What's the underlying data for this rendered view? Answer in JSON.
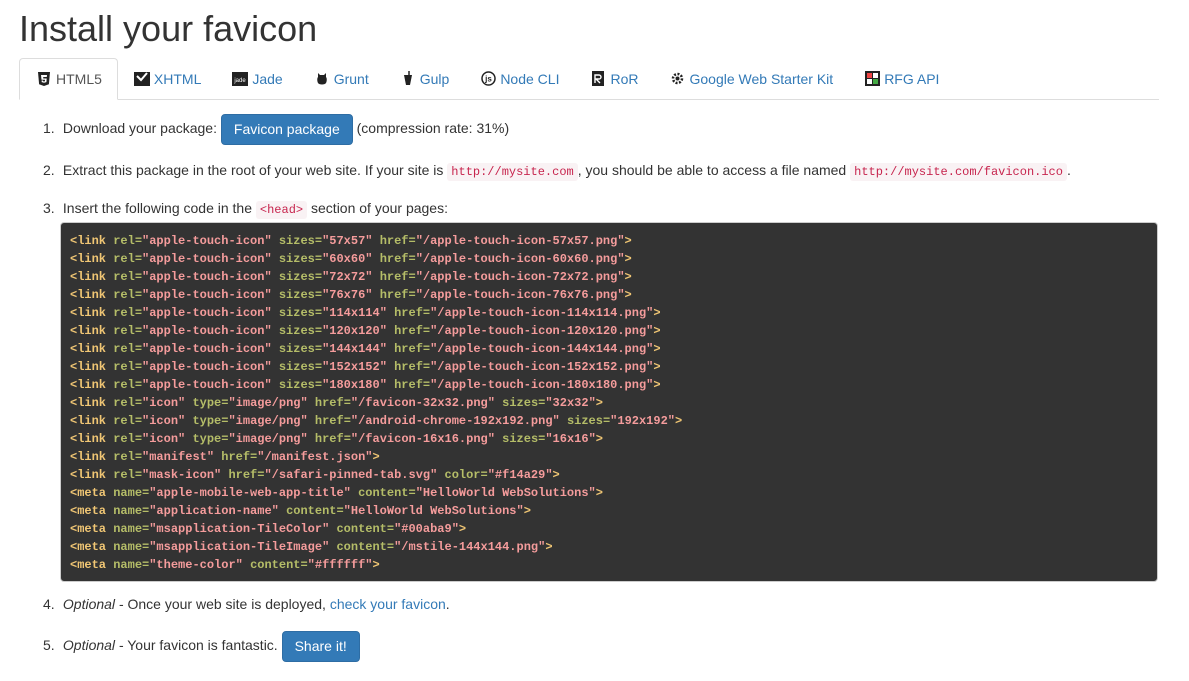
{
  "page": {
    "title": "Install your favicon"
  },
  "tabs": [
    {
      "label": "HTML5",
      "icon": "html5-icon",
      "active": true
    },
    {
      "label": "XHTML",
      "icon": "xhtml-icon"
    },
    {
      "label": "Jade",
      "icon": "jade-icon"
    },
    {
      "label": "Grunt",
      "icon": "grunt-icon"
    },
    {
      "label": "Gulp",
      "icon": "gulp-icon"
    },
    {
      "label": "Node CLI",
      "icon": "node-cli-icon"
    },
    {
      "label": "RoR",
      "icon": "ror-icon"
    },
    {
      "label": "Google Web Starter Kit",
      "icon": "gear-icon"
    },
    {
      "label": "RFG API",
      "icon": "rfg-api-icon"
    }
  ],
  "steps": {
    "s1": {
      "num": "1.",
      "text": "Download your package:",
      "button": "Favicon package",
      "after": "(compression rate: 31%)"
    },
    "s2": {
      "num": "2.",
      "text1": "Extract this package in the root of your web site. If your site is",
      "code1": "http://mysite.com",
      "text2": ", you should be able to access a file named",
      "code2": "http://mysite.com/favicon.ico",
      "text3": "."
    },
    "s3": {
      "num": "3.",
      "text1": "Insert the following code in the",
      "code": "<head>",
      "text2": "section of your pages:"
    },
    "s4": {
      "num": "4.",
      "optional": "Optional",
      "text": "- Once your web site is deployed,",
      "link": "check your favicon",
      "end": "."
    },
    "s5": {
      "num": "5.",
      "optional": "Optional",
      "text": "- Your favicon is fantastic.",
      "button": "Share it!"
    }
  },
  "code_lines": [
    [
      [
        "t",
        "<link "
      ],
      [
        "a",
        "rel="
      ],
      [
        "s",
        "\"apple-touch-icon\" "
      ],
      [
        "a",
        "sizes="
      ],
      [
        "s",
        "\"57x57\" "
      ],
      [
        "a",
        "href="
      ],
      [
        "s",
        "\"/apple-touch-icon-57x57.png\""
      ],
      [
        "t",
        ">"
      ]
    ],
    [
      [
        "t",
        "<link "
      ],
      [
        "a",
        "rel="
      ],
      [
        "s",
        "\"apple-touch-icon\" "
      ],
      [
        "a",
        "sizes="
      ],
      [
        "s",
        "\"60x60\" "
      ],
      [
        "a",
        "href="
      ],
      [
        "s",
        "\"/apple-touch-icon-60x60.png\""
      ],
      [
        "t",
        ">"
      ]
    ],
    [
      [
        "t",
        "<link "
      ],
      [
        "a",
        "rel="
      ],
      [
        "s",
        "\"apple-touch-icon\" "
      ],
      [
        "a",
        "sizes="
      ],
      [
        "s",
        "\"72x72\" "
      ],
      [
        "a",
        "href="
      ],
      [
        "s",
        "\"/apple-touch-icon-72x72.png\""
      ],
      [
        "t",
        ">"
      ]
    ],
    [
      [
        "t",
        "<link "
      ],
      [
        "a",
        "rel="
      ],
      [
        "s",
        "\"apple-touch-icon\" "
      ],
      [
        "a",
        "sizes="
      ],
      [
        "s",
        "\"76x76\" "
      ],
      [
        "a",
        "href="
      ],
      [
        "s",
        "\"/apple-touch-icon-76x76.png\""
      ],
      [
        "t",
        ">"
      ]
    ],
    [
      [
        "t",
        "<link "
      ],
      [
        "a",
        "rel="
      ],
      [
        "s",
        "\"apple-touch-icon\" "
      ],
      [
        "a",
        "sizes="
      ],
      [
        "s",
        "\"114x114\" "
      ],
      [
        "a",
        "href="
      ],
      [
        "s",
        "\"/apple-touch-icon-114x114.png\""
      ],
      [
        "t",
        ">"
      ]
    ],
    [
      [
        "t",
        "<link "
      ],
      [
        "a",
        "rel="
      ],
      [
        "s",
        "\"apple-touch-icon\" "
      ],
      [
        "a",
        "sizes="
      ],
      [
        "s",
        "\"120x120\" "
      ],
      [
        "a",
        "href="
      ],
      [
        "s",
        "\"/apple-touch-icon-120x120.png\""
      ],
      [
        "t",
        ">"
      ]
    ],
    [
      [
        "t",
        "<link "
      ],
      [
        "a",
        "rel="
      ],
      [
        "s",
        "\"apple-touch-icon\" "
      ],
      [
        "a",
        "sizes="
      ],
      [
        "s",
        "\"144x144\" "
      ],
      [
        "a",
        "href="
      ],
      [
        "s",
        "\"/apple-touch-icon-144x144.png\""
      ],
      [
        "t",
        ">"
      ]
    ],
    [
      [
        "t",
        "<link "
      ],
      [
        "a",
        "rel="
      ],
      [
        "s",
        "\"apple-touch-icon\" "
      ],
      [
        "a",
        "sizes="
      ],
      [
        "s",
        "\"152x152\" "
      ],
      [
        "a",
        "href="
      ],
      [
        "s",
        "\"/apple-touch-icon-152x152.png\""
      ],
      [
        "t",
        ">"
      ]
    ],
    [
      [
        "t",
        "<link "
      ],
      [
        "a",
        "rel="
      ],
      [
        "s",
        "\"apple-touch-icon\" "
      ],
      [
        "a",
        "sizes="
      ],
      [
        "s",
        "\"180x180\" "
      ],
      [
        "a",
        "href="
      ],
      [
        "s",
        "\"/apple-touch-icon-180x180.png\""
      ],
      [
        "t",
        ">"
      ]
    ],
    [
      [
        "t",
        "<link "
      ],
      [
        "a",
        "rel="
      ],
      [
        "s",
        "\"icon\" "
      ],
      [
        "a",
        "type="
      ],
      [
        "s",
        "\"image/png\" "
      ],
      [
        "a",
        "href="
      ],
      [
        "s",
        "\"/favicon-32x32.png\" "
      ],
      [
        "a",
        "sizes="
      ],
      [
        "s",
        "\"32x32\""
      ],
      [
        "t",
        ">"
      ]
    ],
    [
      [
        "t",
        "<link "
      ],
      [
        "a",
        "rel="
      ],
      [
        "s",
        "\"icon\" "
      ],
      [
        "a",
        "type="
      ],
      [
        "s",
        "\"image/png\" "
      ],
      [
        "a",
        "href="
      ],
      [
        "s",
        "\"/android-chrome-192x192.png\" "
      ],
      [
        "a",
        "sizes="
      ],
      [
        "s",
        "\"192x192\""
      ],
      [
        "t",
        ">"
      ]
    ],
    [
      [
        "t",
        "<link "
      ],
      [
        "a",
        "rel="
      ],
      [
        "s",
        "\"icon\" "
      ],
      [
        "a",
        "type="
      ],
      [
        "s",
        "\"image/png\" "
      ],
      [
        "a",
        "href="
      ],
      [
        "s",
        "\"/favicon-16x16.png\" "
      ],
      [
        "a",
        "sizes="
      ],
      [
        "s",
        "\"16x16\""
      ],
      [
        "t",
        ">"
      ]
    ],
    [
      [
        "t",
        "<link "
      ],
      [
        "a",
        "rel="
      ],
      [
        "s",
        "\"manifest\" "
      ],
      [
        "a",
        "href="
      ],
      [
        "s",
        "\"/manifest.json\""
      ],
      [
        "t",
        ">"
      ]
    ],
    [
      [
        "t",
        "<link "
      ],
      [
        "a",
        "rel="
      ],
      [
        "s",
        "\"mask-icon\" "
      ],
      [
        "a",
        "href="
      ],
      [
        "s",
        "\"/safari-pinned-tab.svg\" "
      ],
      [
        "a",
        "color="
      ],
      [
        "s",
        "\"#f14a29\""
      ],
      [
        "t",
        ">"
      ]
    ],
    [
      [
        "t",
        "<meta "
      ],
      [
        "a",
        "name="
      ],
      [
        "s",
        "\"apple-mobile-web-app-title\" "
      ],
      [
        "a",
        "content="
      ],
      [
        "s",
        "\"HelloWorld WebSolutions\""
      ],
      [
        "t",
        ">"
      ]
    ],
    [
      [
        "t",
        "<meta "
      ],
      [
        "a",
        "name="
      ],
      [
        "s",
        "\"application-name\" "
      ],
      [
        "a",
        "content="
      ],
      [
        "s",
        "\"HelloWorld WebSolutions\""
      ],
      [
        "t",
        ">"
      ]
    ],
    [
      [
        "t",
        "<meta "
      ],
      [
        "a",
        "name="
      ],
      [
        "s",
        "\"msapplication-TileColor\" "
      ],
      [
        "a",
        "content="
      ],
      [
        "s",
        "\"#00aba9\""
      ],
      [
        "t",
        ">"
      ]
    ],
    [
      [
        "t",
        "<meta "
      ],
      [
        "a",
        "name="
      ],
      [
        "s",
        "\"msapplication-TileImage\" "
      ],
      [
        "a",
        "content="
      ],
      [
        "s",
        "\"/mstile-144x144.png\""
      ],
      [
        "t",
        ">"
      ]
    ],
    [
      [
        "t",
        "<meta "
      ],
      [
        "a",
        "name="
      ],
      [
        "s",
        "\"theme-color\" "
      ],
      [
        "a",
        "content="
      ],
      [
        "s",
        "\"#ffffff\""
      ],
      [
        "t",
        ">"
      ]
    ]
  ],
  "colors": {
    "link": "#337ab7",
    "button": "#337ab7",
    "code_bg": "#333333",
    "code_inline": "#c7254e"
  }
}
